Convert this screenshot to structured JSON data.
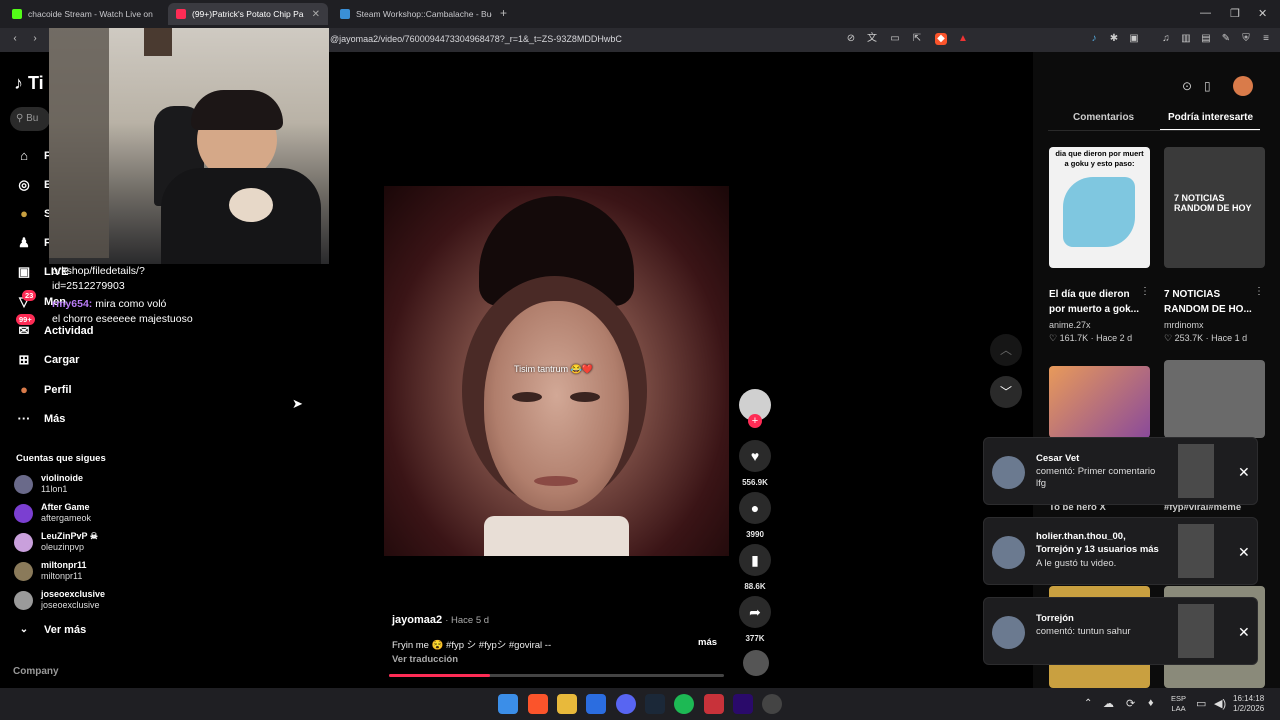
{
  "tabs": [
    {
      "label": "chacoide Stream - Watch Live on",
      "fav_color": "#53fc18"
    },
    {
      "label": "(99+)Patrick's Potato Chip Pa",
      "fav_color": "#fe2c55"
    },
    {
      "label": "Steam Workshop::Cambalache - Bue",
      "fav_color": "#3a8fd6"
    }
  ],
  "url": "@jayomaa2/video/7600094473304968478?_r=1&_t=ZS-93Z8MDDHwbC",
  "chat": {
    "line1": "orkshop/filedetails/?",
    "line2": "id=2512279903",
    "user": "rmy654:",
    "msg_inline": "mira como voló",
    "msg2": "el chorro eseeeee majestuoso",
    "badge": "23"
  },
  "sidebar": {
    "logo_partial": "Ti",
    "search_partial": "Bu",
    "nav": [
      {
        "label": "P",
        "icon": "home-icon",
        "glyph": "⌂"
      },
      {
        "label": "E",
        "icon": "compass-icon",
        "glyph": "◎"
      },
      {
        "label": "S",
        "icon": "avatar-icon",
        "glyph": "●"
      },
      {
        "label": "F",
        "icon": "people-icon",
        "glyph": "♟"
      },
      {
        "label": "LIVE",
        "icon": "live-icon",
        "glyph": "▣"
      },
      {
        "label": "Men",
        "icon": "inbox-icon",
        "glyph": "▽"
      },
      {
        "label": "Actividad",
        "icon": "activity-icon",
        "glyph": "✉",
        "badge": "99+"
      },
      {
        "label": "Cargar",
        "icon": "upload-icon",
        "glyph": "⊞"
      },
      {
        "label": "Perfil",
        "icon": "profile-icon",
        "glyph": "●"
      },
      {
        "label": "Más",
        "icon": "more-icon",
        "glyph": "···"
      }
    ],
    "following_title": "Cuentas que sigues",
    "accounts": [
      {
        "name": "violinoide",
        "user": "11lon1",
        "color": "#6a6a8a"
      },
      {
        "name": "After Game",
        "user": "aftergameok",
        "color": "#7b3fd1"
      },
      {
        "name": "LeuZinPvP ☠",
        "user": "oleuzinpvp",
        "color": "#c9a0dc"
      },
      {
        "name": "miltonpr11",
        "user": "miltonpr11",
        "color": "#8a7a5a"
      },
      {
        "name": "joseoexclusive",
        "user": "joseoexclusive",
        "color": "#9a9a9a"
      }
    ],
    "see_more": "Ver más",
    "company": "Company"
  },
  "video": {
    "caption_overlay": "Tisim tantrum 😂❤️",
    "author": "jayomaa2",
    "time": "Hace 5 d",
    "description": "Fryin me 😵 #fyp シ #fypシ #goviral --",
    "more": "más",
    "translate": "Ver traducción",
    "progress": 0.3
  },
  "actions": {
    "likes": "556.9K",
    "comments": "3990",
    "saves": "88.6K",
    "shares": "377K"
  },
  "right_panel": {
    "tab_comments": "Comentarios",
    "tab_interest": "Podría interesarte",
    "videos": [
      {
        "thumb_text": "dia que dieron por muert a goku y esto paso:",
        "title": "El día que dieron por muerto a gok...",
        "author": "anime.27x",
        "likes": "161.7K",
        "time": "Hace 2 d",
        "bg": "#f2f2f2"
      },
      {
        "thumb_text": "7 NOTICIAS RANDOM DE HOY",
        "title": "7 NOTICIAS RANDOM DE HO...",
        "author": "mrdinomx",
        "likes": "253.7K",
        "time": "Hace 1 d",
        "bg": "#3a3a3a"
      }
    ],
    "partial_left": "To be hero X",
    "partial_right": "#fyp#viral#meme"
  },
  "notifications": [
    {
      "title": "Cesar Vet",
      "text": "comentó: Primer comentario lfg"
    },
    {
      "title": "holier.than.thou_00, Torrejón y 13 usuarios más",
      "text": "A le gustó tu video."
    },
    {
      "title": "Torrejón",
      "text": "comentó: tuntun sahur"
    }
  ],
  "taskbar": {
    "lang1": "ESP",
    "lang2": "LAA",
    "time": "16:14:18",
    "date": "1/2/2026"
  }
}
